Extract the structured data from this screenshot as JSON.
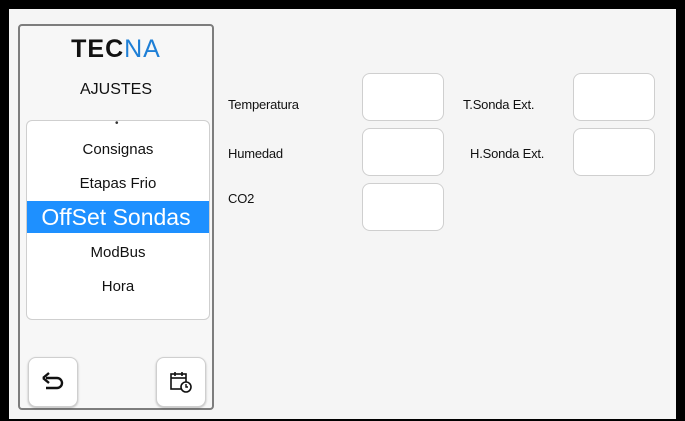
{
  "sidebar": {
    "logo_part1": "TEC",
    "logo_part2": "NA",
    "title": "AJUSTES",
    "menu_items": [
      "Consignas",
      "Etapas Frio",
      "OffSet Sondas",
      "ModBus",
      "Hora"
    ],
    "selected_item": "OffSet Sondas"
  },
  "buttons": {
    "back_icon": "back-arrow-icon",
    "calendar_icon": "calendar-clock-icon"
  },
  "fields": {
    "temperatura": {
      "label": "Temperatura",
      "value": ""
    },
    "humedad": {
      "label": "Humedad",
      "value": ""
    },
    "co2": {
      "label": "CO2",
      "value": ""
    },
    "t_sonda_ext": {
      "label": "T.Sonda Ext.",
      "value": ""
    },
    "h_sonda_ext": {
      "label": "H.Sonda Ext.",
      "value": ""
    }
  },
  "colors": {
    "accent": "#1e90ff",
    "logo_accent": "#1e7fd6"
  }
}
